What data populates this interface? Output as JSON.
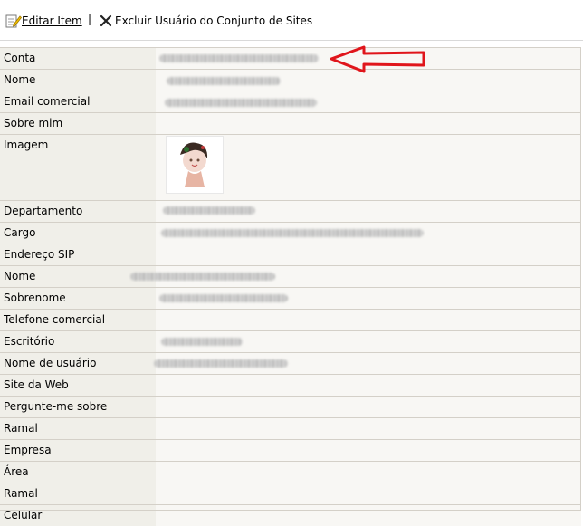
{
  "toolbar": {
    "edit_label": "Editar Item",
    "separator": "|",
    "delete_label": "Excluir Usuário do Conjunto de Sites"
  },
  "fields": [
    "Conta",
    "Nome",
    "Email comercial",
    "Sobre mim",
    "Imagem",
    "Departamento",
    "Cargo",
    "Endereço SIP",
    "Nome",
    "Sobrenome",
    "Telefone comercial",
    "Escritório",
    "Nome de usuário",
    "Site da Web",
    "Pergunte-me sobre",
    "Ramal",
    "Empresa",
    "Área",
    "Ramal",
    "Celular"
  ],
  "colors": {
    "arrow": "#e0151b",
    "label_bg": "#f0efe9",
    "value_bg": "#f8f7f4",
    "row_border": "#d4d0c8"
  }
}
